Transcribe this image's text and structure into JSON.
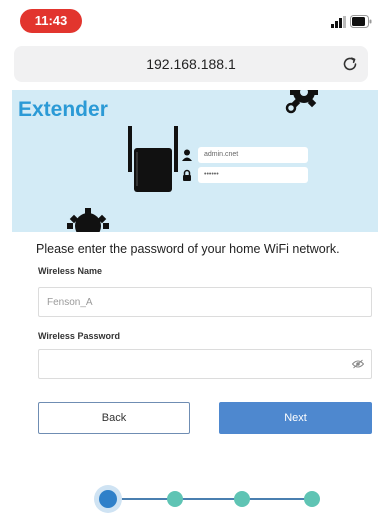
{
  "status_bar": {
    "time": "11:43",
    "time_pill_color": "#e2352e",
    "signal_icon": "cellular-signal-icon",
    "battery_icon": "battery-icon"
  },
  "browser": {
    "url": "192.168.188.1",
    "reload_icon": "reload-icon"
  },
  "banner": {
    "title": "Extender",
    "background_color": "#d3ebf6",
    "title_color": "#2b9ad6",
    "username_placeholder": "admin.cnet",
    "password_mask": "••••••"
  },
  "form": {
    "instruction": "Please enter the password of your home WiFi network.",
    "wireless_name_label": "Wireless Name",
    "wireless_name_value": "Fenson_A",
    "wireless_password_label": "Wireless Password",
    "wireless_password_value": "",
    "eye_icon": "eye-icon"
  },
  "buttons": {
    "back_label": "Back",
    "next_label": "Next",
    "next_color": "#4e88cf"
  },
  "progress": {
    "total_steps": 4,
    "current_step": 1,
    "active_color": "#2f80c9",
    "inactive_color": "#5fc4b4"
  }
}
